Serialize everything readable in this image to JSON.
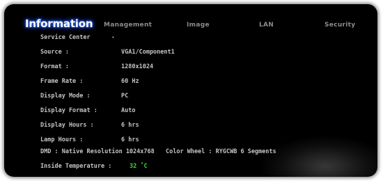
{
  "tabs": [
    {
      "label": "Information"
    },
    {
      "label": "Management"
    },
    {
      "label": "Image"
    },
    {
      "label": "LAN"
    },
    {
      "label": "Security"
    }
  ],
  "service_center": {
    "label": "Service Center",
    "arrow": "▸",
    "arrow_icon": "triangle-right-icon"
  },
  "info": {
    "source": {
      "label": "Source :",
      "value": "VGA1/Component1"
    },
    "format": {
      "label": "Format :",
      "value": "1280x1024"
    },
    "frame_rate": {
      "label": "Frame Rate :",
      "value": "60 Hz"
    },
    "display_mode": {
      "label": "Display Mode :",
      "value": "PC"
    },
    "display_format": {
      "label": "Display Format :",
      "value": "Auto"
    },
    "display_hours": {
      "label": "Display Hours :",
      "value": "6 hrs"
    },
    "lamp_hours": {
      "label": "Lamp Hours :",
      "value": "6 hrs"
    },
    "dmd": "DMD : Native Resolution 1024x768",
    "color_wheel": "Color Wheel : RYGCWB 6 Segments",
    "inside_temperature": {
      "label": "Inside Temperature :",
      "value": "32 ˚C"
    }
  },
  "colors": {
    "background": "#000000",
    "active_tab_glow": "#2a5cff",
    "text": "#c4c4c4",
    "temperature": "#3fdc3f"
  }
}
